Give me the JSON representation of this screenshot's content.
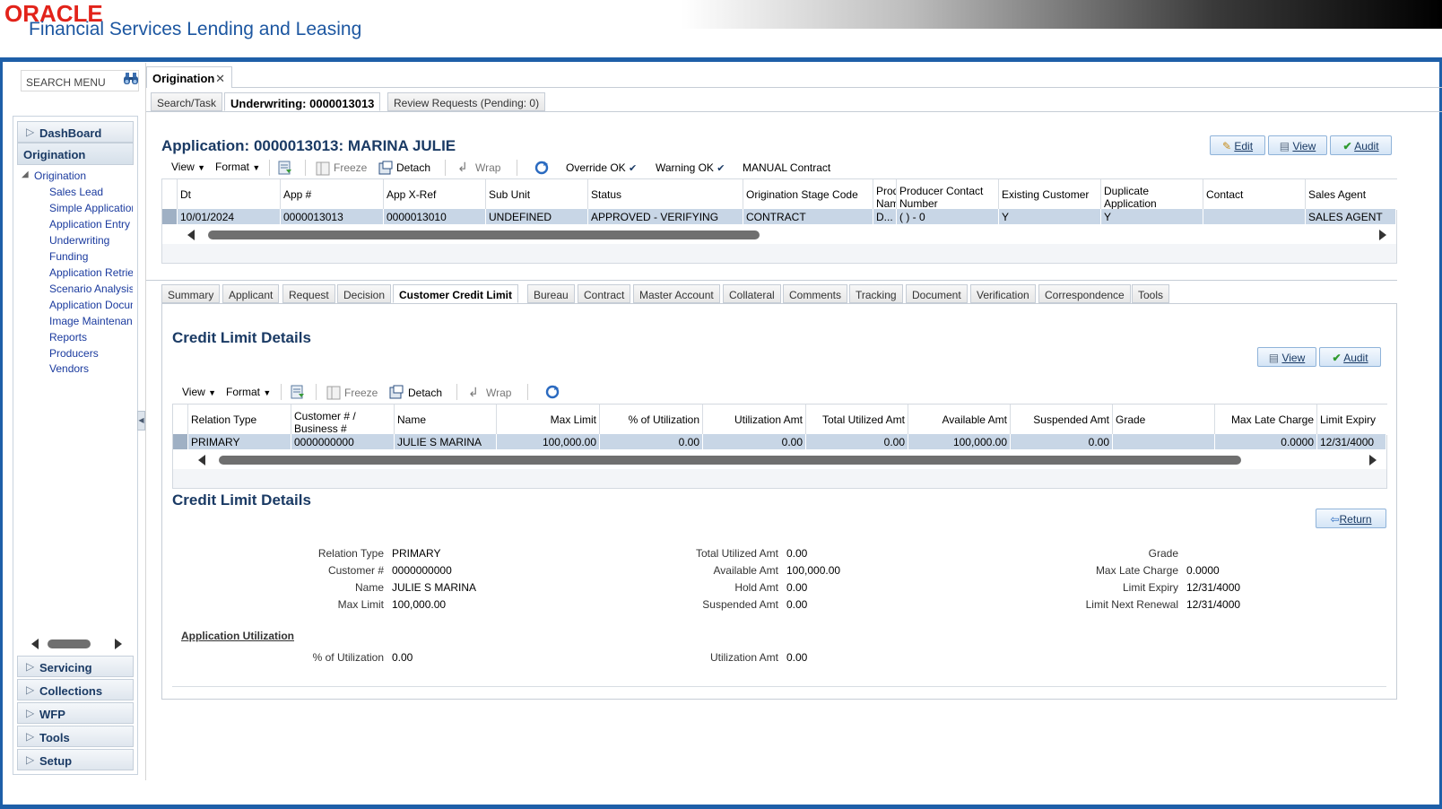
{
  "branding": {
    "logo": "ORACLE",
    "product": "Financial Services Lending and Leasing"
  },
  "sidebar": {
    "search_placeholder": "SEARCH MENU",
    "dashboard": "DashBoard",
    "origination_header": "Origination",
    "tree_root": "Origination",
    "tree_items": [
      "Sales Lead",
      "Simple Application",
      "Application Entry",
      "Underwriting",
      "Funding",
      "Application Retrieval",
      "Scenario Analysis",
      "Application Document",
      "Image Maintenance",
      "Reports",
      "Producers",
      "Vendors"
    ],
    "bottom": [
      "Servicing",
      "Collections",
      "WFP",
      "Tools",
      "Setup"
    ]
  },
  "primary_tab": {
    "label": "Origination"
  },
  "subtabs": [
    "Search/Task",
    "Underwriting: 0000013013",
    "Review Requests (Pending: 0)"
  ],
  "application": {
    "title": "Application: 0000013013: MARINA JULIE",
    "buttons": {
      "edit": "Edit",
      "view": "View",
      "audit": "Audit"
    },
    "toolbar": {
      "view": "View",
      "format": "Format",
      "freeze": "Freeze",
      "detach": "Detach",
      "wrap": "Wrap",
      "override": "Override OK",
      "warning": "Warning OK",
      "manual": "MANUAL Contract"
    },
    "columns": [
      "Dt",
      "App #",
      "App X-Ref",
      "Sub Unit",
      "Status",
      "Origination Stage Code",
      "Prod Nam",
      "Producer Contact Number",
      "Existing Customer",
      "Duplicate Application",
      "Contact",
      "Sales Agent"
    ],
    "row": [
      "10/01/2024",
      "0000013013",
      "0000013010",
      "UNDEFINED",
      "APPROVED - VERIFYING",
      "CONTRACT",
      "D...",
      "( ) - 0",
      "Y",
      "Y",
      "",
      "SALES AGENT"
    ]
  },
  "detail_tabs": [
    "Summary",
    "Applicant",
    "Request",
    "Decision",
    "Customer Credit Limit",
    "Bureau",
    "Contract",
    "Master Account",
    "Collateral",
    "Comments",
    "Tracking",
    "Document",
    "Verification",
    "Correspondence",
    "Tools"
  ],
  "active_detail_tab": "Customer Credit Limit",
  "credit_limit": {
    "title": "Credit Limit Details",
    "buttons": {
      "view": "View",
      "audit": "Audit"
    },
    "toolbar": {
      "view": "View",
      "format": "Format",
      "freeze": "Freeze",
      "detach": "Detach",
      "wrap": "Wrap"
    },
    "columns": [
      "Relation Type",
      "Customer # / Business #",
      "Name",
      "Max Limit",
      "% of Utilization",
      "Utilization Amt",
      "Total Utilized Amt",
      "Available Amt",
      "Suspended Amt",
      "Grade",
      "Max Late Charge",
      "Limit Expiry"
    ],
    "row": [
      "PRIMARY",
      "0000000000",
      "JULIE S MARINA",
      "100,000.00",
      "0.00",
      "0.00",
      "0.00",
      "100,000.00",
      "0.00",
      "",
      "0.0000",
      "12/31/4000"
    ]
  },
  "credit_detail": {
    "title": "Credit Limit Details",
    "return_label": "Return",
    "col1": [
      [
        "Relation Type",
        "PRIMARY"
      ],
      [
        "Customer #",
        "0000000000"
      ],
      [
        "Name",
        "JULIE S MARINA"
      ],
      [
        "Max Limit",
        "100,000.00"
      ]
    ],
    "col2": [
      [
        "Total Utilized Amt",
        "0.00"
      ],
      [
        "Available Amt",
        "100,000.00"
      ],
      [
        "Hold Amt",
        "0.00"
      ],
      [
        "Suspended Amt",
        "0.00"
      ]
    ],
    "col3": [
      [
        "Grade",
        ""
      ],
      [
        "Max Late Charge",
        "0.0000"
      ],
      [
        "Limit Expiry",
        "12/31/4000"
      ],
      [
        "Limit Next Renewal",
        "12/31/4000"
      ]
    ],
    "app_util_title": "Application Utilization",
    "util": [
      [
        "% of Utilization",
        "0.00"
      ],
      [
        "Utilization Amt",
        "0.00"
      ]
    ]
  },
  "colors": {
    "brand_red": "#e2231a",
    "brand_blue": "#1d57a1",
    "frame": "#1e5fa8",
    "selected_row": "#c8d6e6"
  }
}
